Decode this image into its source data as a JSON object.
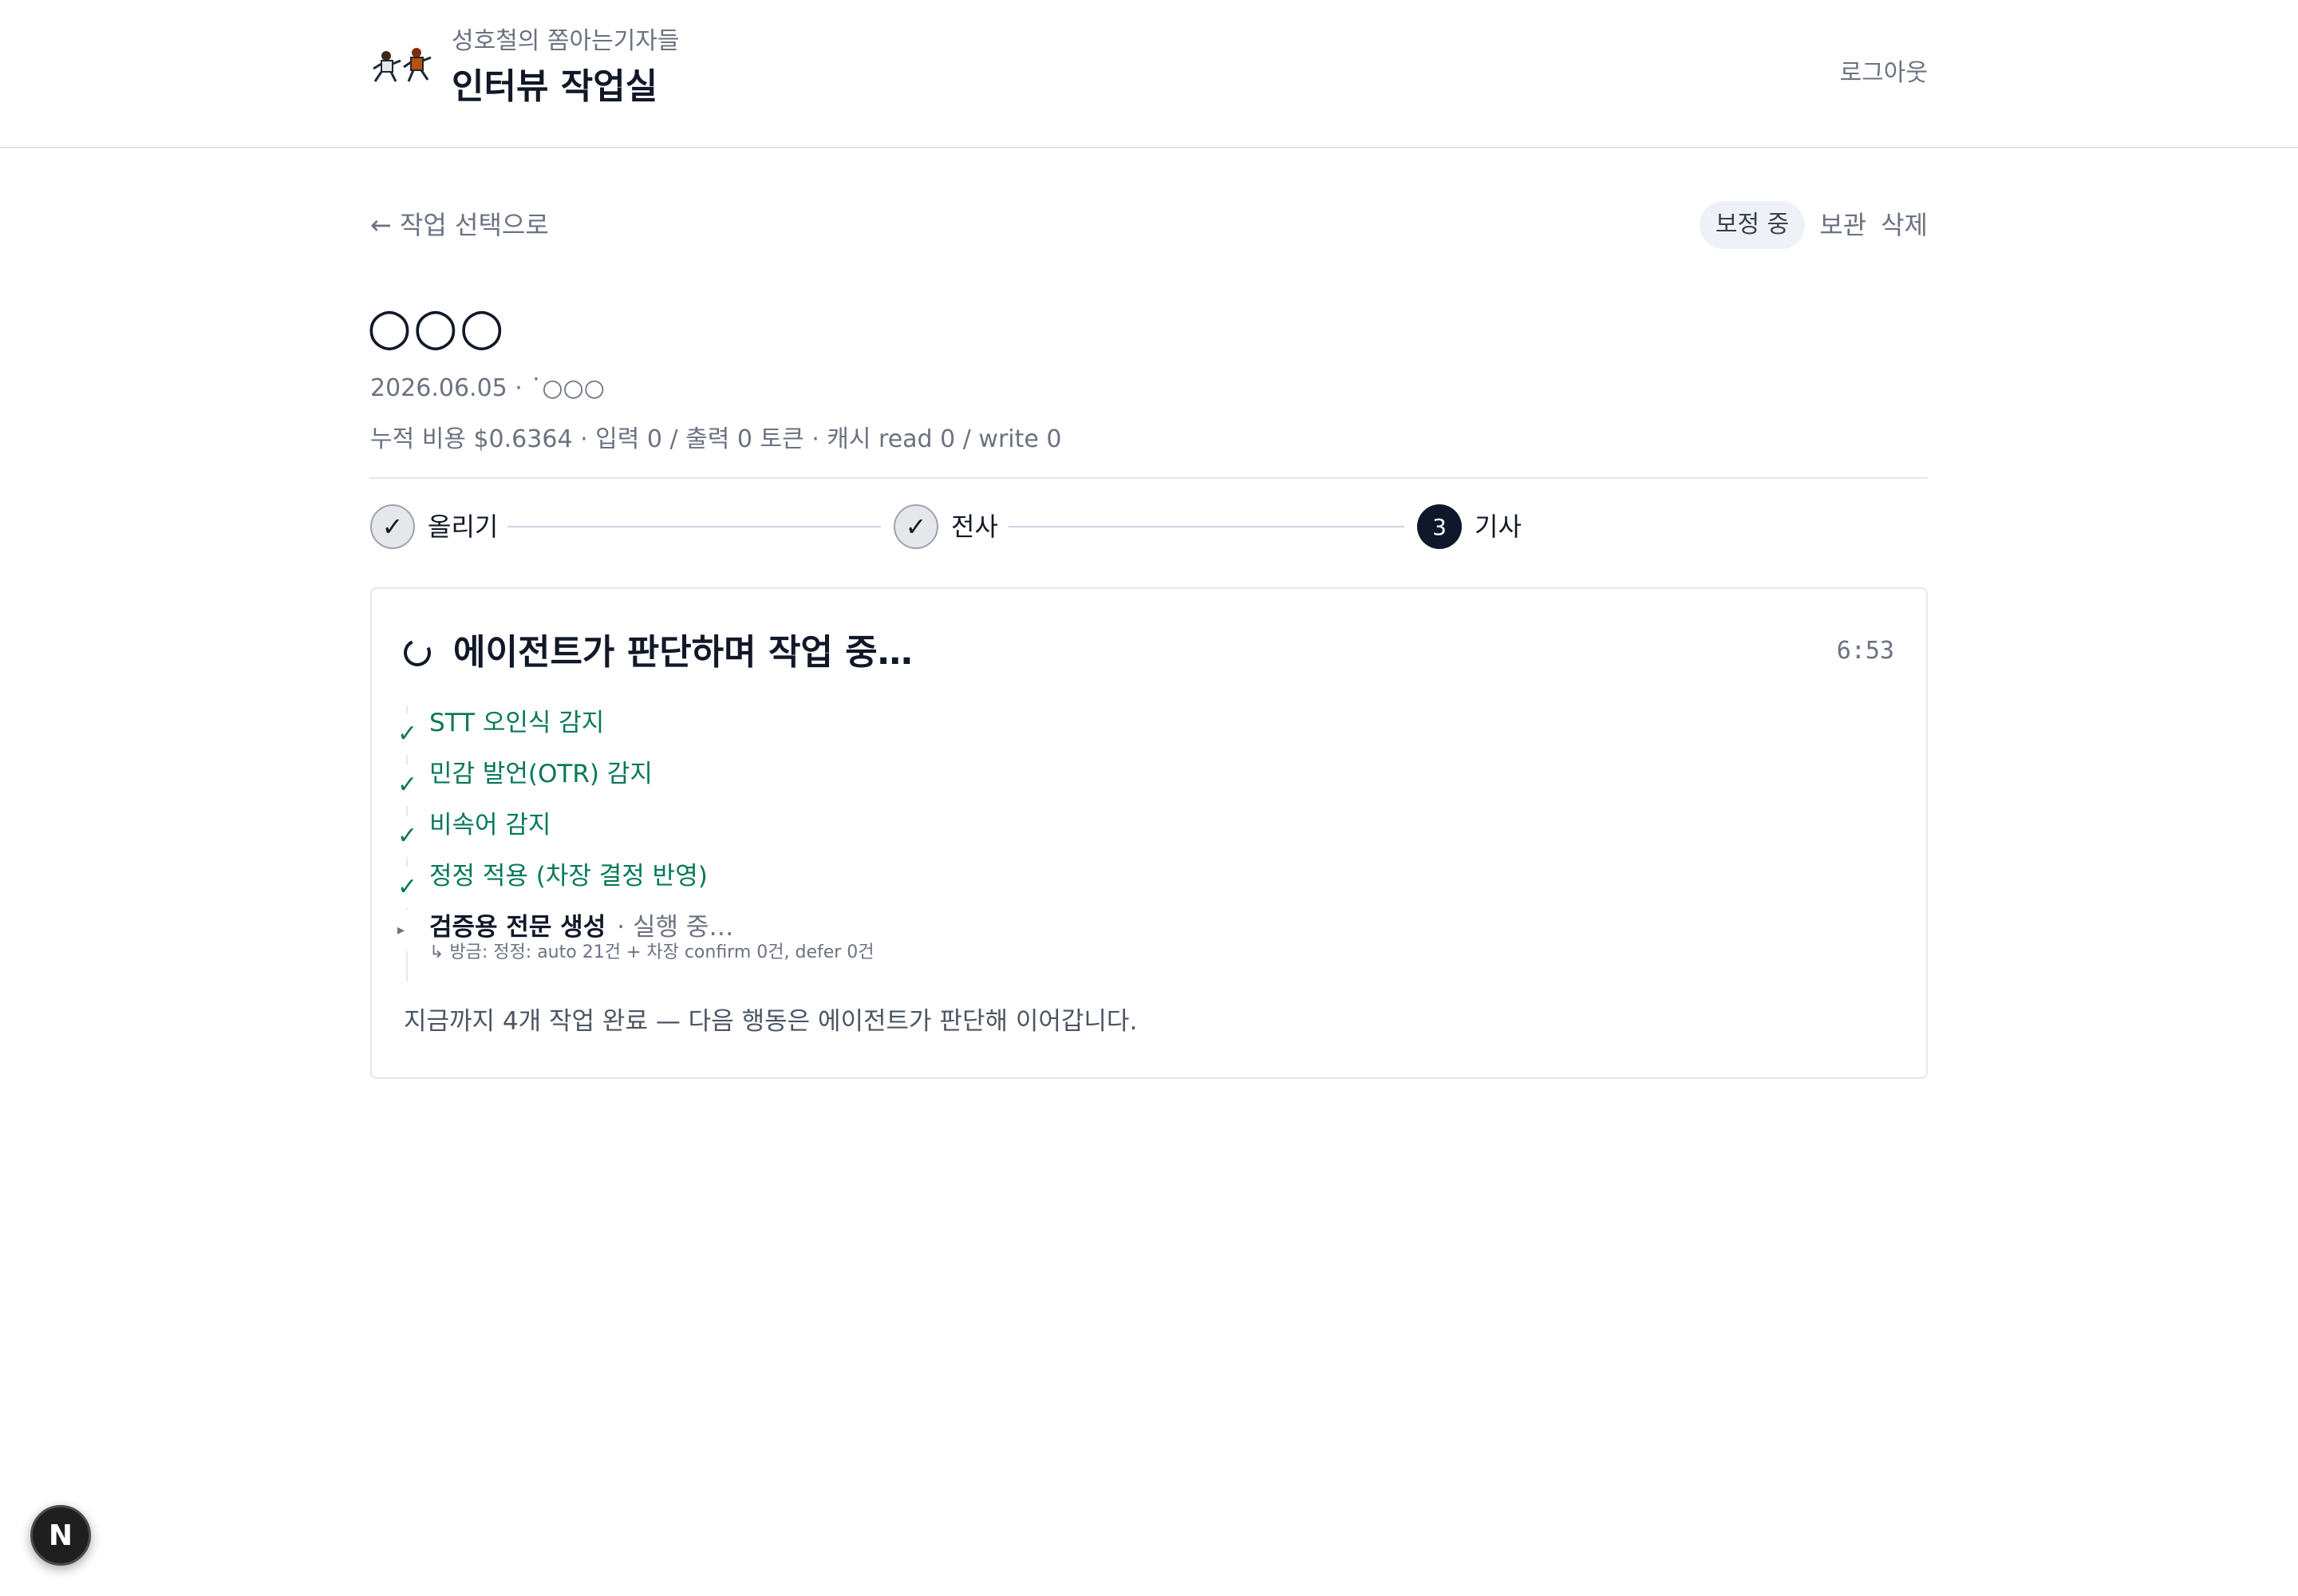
{
  "header": {
    "subtitle": "성호철의 쫌아는기자들",
    "title": "인터뷰 작업실",
    "logout_label": "로그아웃"
  },
  "nav": {
    "back_label": "← 작업 선택으로"
  },
  "actions": {
    "status_pill": "보정 중",
    "archive_label": "보관",
    "delete_label": "삭제"
  },
  "page": {
    "title": "○○○",
    "meta": "2026.06.05 · ˙̇○○○",
    "cost": "누적 비용 $0.6364 · 입력 0 / 출력 0 토큰 · 캐시 read 0 / write 0"
  },
  "stepper": {
    "steps": [
      {
        "label": "올리기",
        "state": "done",
        "marker": "✓"
      },
      {
        "label": "전사",
        "state": "done",
        "marker": "✓"
      },
      {
        "label": "기사",
        "state": "active",
        "marker": "3"
      }
    ]
  },
  "agent": {
    "title": "에이전트가 판단하며 작업 중…",
    "timer": "6:53",
    "tasks": [
      {
        "label": "STT 오인식 감지",
        "icon": "✓"
      },
      {
        "label": "민감 발언(OTR) 감지",
        "icon": "✓"
      },
      {
        "label": "비속어 감지",
        "icon": "✓"
      },
      {
        "label": "정정 적용 (차장 결정 반영)",
        "icon": "✓"
      }
    ],
    "running_task": {
      "icon": "▸",
      "label": "검증용 전문 생성",
      "status": "· 실행 중…",
      "sub": "↳ 방금: 정정: auto 21건 + 차장 confirm 0건, defer 0건"
    },
    "footer": "지금까지 4개 작업 완료 — 다음 행동은 에이전트가 판단해 이어갑니다."
  },
  "badge": {
    "letter": "N"
  },
  "colors": {
    "success": "#047857",
    "muted": "#6b7280",
    "active_step": "#0f172a",
    "pill_bg": "#eef2f7"
  }
}
